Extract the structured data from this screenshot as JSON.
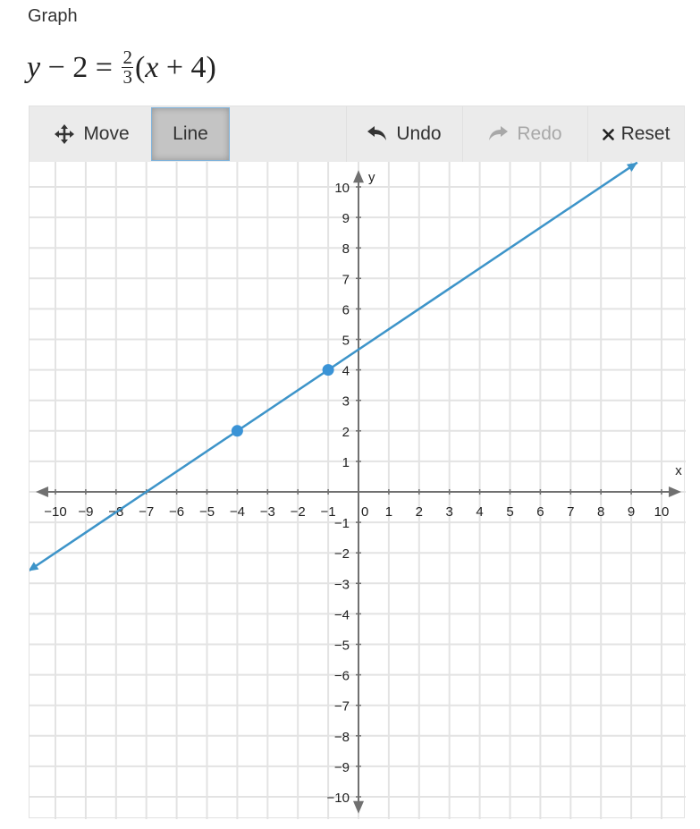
{
  "page": {
    "heading": "Graph",
    "equation": {
      "lhs_var": "y",
      "lhs_rest": " − 2 = ",
      "frac_num": "2",
      "frac_den": "3",
      "rhs_open": "(",
      "rhs_var": "x",
      "rhs_rest": " + 4)"
    }
  },
  "toolbar": {
    "move_label": "Move",
    "line_label": "Line",
    "undo_label": "Undo",
    "redo_label": "Redo",
    "reset_label": "Reset",
    "active_tool": "Line",
    "redo_enabled": false
  },
  "chart_data": {
    "type": "line",
    "title": "",
    "xlabel": "x",
    "ylabel": "y",
    "xlim": [
      -10,
      10
    ],
    "ylim": [
      -10,
      10
    ],
    "grid": true,
    "x_ticks": [
      -10,
      -9,
      -8,
      -7,
      -6,
      -5,
      -4,
      -3,
      -2,
      -1,
      0,
      1,
      2,
      3,
      4,
      5,
      6,
      7,
      8,
      9,
      10
    ],
    "y_ticks": [
      -10,
      -9,
      -8,
      -7,
      -6,
      -5,
      -4,
      -3,
      -2,
      -1,
      1,
      2,
      3,
      4,
      5,
      6,
      7,
      8,
      9,
      10
    ],
    "series": [
      {
        "name": "line",
        "kind": "infinite-line",
        "slope": 0.6667,
        "points": [
          {
            "x": -4,
            "y": 2
          },
          {
            "x": -1,
            "y": 4
          }
        ],
        "color": "#3d94c9"
      }
    ],
    "point_color": "#3a93d6",
    "axis_color": "#707070",
    "grid_color": "#e3e3e3"
  }
}
